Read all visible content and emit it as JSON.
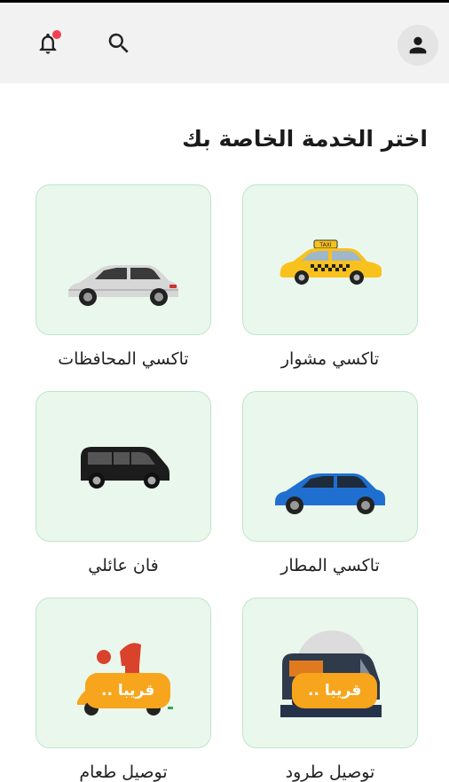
{
  "header": {
    "notification_icon": "bell-icon",
    "search_icon": "search-icon",
    "profile_icon": "person-icon",
    "notification_dot_color": "#f0414f"
  },
  "page": {
    "title": "اختر الخدمة الخاصة بك"
  },
  "services": [
    {
      "label": "تاكسي مشوار",
      "icon": "yellow-taxi-image",
      "badge": ""
    },
    {
      "label": "تاكسي المحافظات",
      "icon": "silver-car-image",
      "badge": ""
    },
    {
      "label": "تاكسي المطار",
      "icon": "blue-car-image",
      "badge": ""
    },
    {
      "label": "فان عائلي",
      "icon": "black-van-image",
      "badge": ""
    },
    {
      "label": "توصيل طرود",
      "icon": "delivery-van-image",
      "badge": "قريبا .."
    },
    {
      "label": "توصيل طعام",
      "icon": "food-delivery-scooter-image",
      "badge": "قريبا .."
    }
  ],
  "colors": {
    "accent": "#f7a51c",
    "card_bg": "#eaf7ec",
    "card_border": "#bfe6c8"
  }
}
